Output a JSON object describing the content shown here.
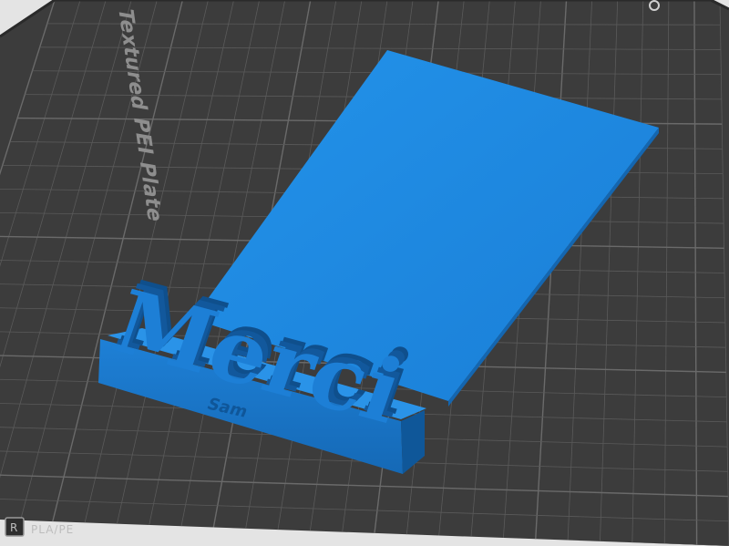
{
  "window": {
    "title": ""
  },
  "build_plate": {
    "label": "Textured PEI Plate",
    "badge_letter": "R",
    "filament_label": "PLA/PE",
    "colors": {
      "plate": "#3d3d3d",
      "grid": "#5a5a5a",
      "grid_major": "#6a6a6a",
      "edge": "#2a2a2a"
    }
  },
  "model": {
    "main_text": "Merci",
    "sub_text": "Sam",
    "colors": {
      "front": "#1c7fd4",
      "top": "#2a93e8",
      "side": "#1565b0",
      "dark": "#0e4f8e",
      "card": "#1e86db"
    }
  }
}
